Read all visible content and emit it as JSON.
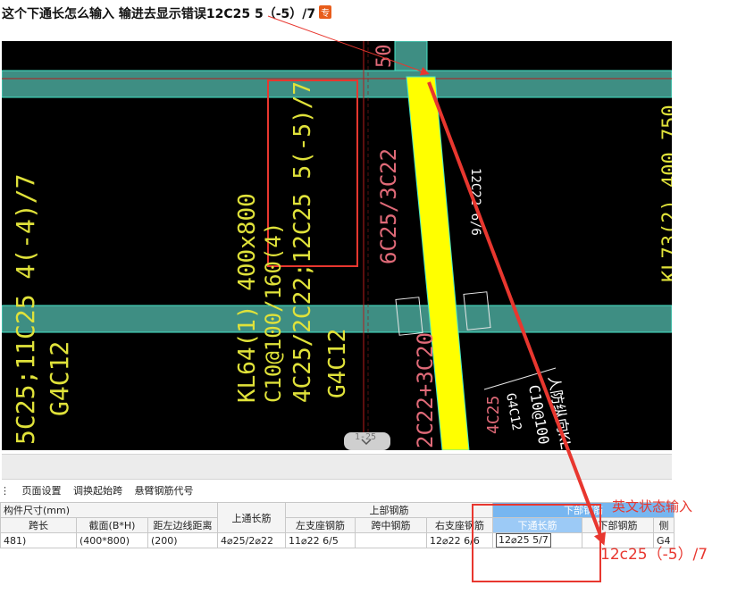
{
  "question": {
    "text": "这个下通长怎么输入 输进去显示错误12C25 5（-5）/7",
    "badge": "专"
  },
  "cad": {
    "labels": {
      "kl64": "KL64(1) 400x800",
      "stirrup": "C10@100/160(4)",
      "top_bottom": "4C25/2C22;12C25 5(-5)/7",
      "g4c12": "G4C12",
      "left_beam": "5C25;11C25 4(-4)/7",
      "left_g": "G4C12",
      "c22_66": "12C22 6/6",
      "c25_3c22": "6C25/3C22",
      "c22_plus": "2C22+3C20",
      "right_vert": "KL73(2) 400 750",
      "g4c12_right": "G4C12",
      "c10_100": "C10@100",
      "fangzong": "人防纵向KL",
      "top_50": "50",
      "c25_small": "4C25",
      "bottom_lbl": "1-25"
    }
  },
  "toolbar": {
    "items": [
      "页面设置",
      "调换起始跨",
      "悬臂钢筋代号"
    ]
  },
  "table": {
    "group_size": "构件尺寸(mm)",
    "group_top": "上部钢筋",
    "group_bottom": "下部钢筋",
    "col_span_length": "跨长",
    "col_section": "截面(B*H)",
    "col_offset": "距左边线距离",
    "col_top_through": "上通长筋",
    "col_left_support": "左支座钢筋",
    "col_mid": "跨中钢筋",
    "col_right_support": "右支座钢筋",
    "col_bottom_through": "下通长筋",
    "col_bottom_rebar": "下部钢筋",
    "col_side": "侧",
    "row": {
      "span_length": "481)",
      "section": "(400*800)",
      "offset": "(200)",
      "top_through": "4⌀25/2⌀22",
      "left_support": "11⌀22 6/5",
      "mid": "",
      "right_support": "12⌀22 6/6",
      "bottom_through": "12⌀25 5/7",
      "bottom_rebar": "",
      "side": "G4"
    }
  },
  "annotation": {
    "label": "英文状态输入",
    "value": "12c25（-5）/7"
  },
  "colors": {
    "beam_fill": "#3e8e83",
    "beam_edge": "#46e6c8",
    "text_yellow": "#e0e23a",
    "text_pink": "#e06a78",
    "highlight_yellow": "#ffff00",
    "annotation_red": "#e8372f",
    "header_blue": "#77b6f0"
  }
}
